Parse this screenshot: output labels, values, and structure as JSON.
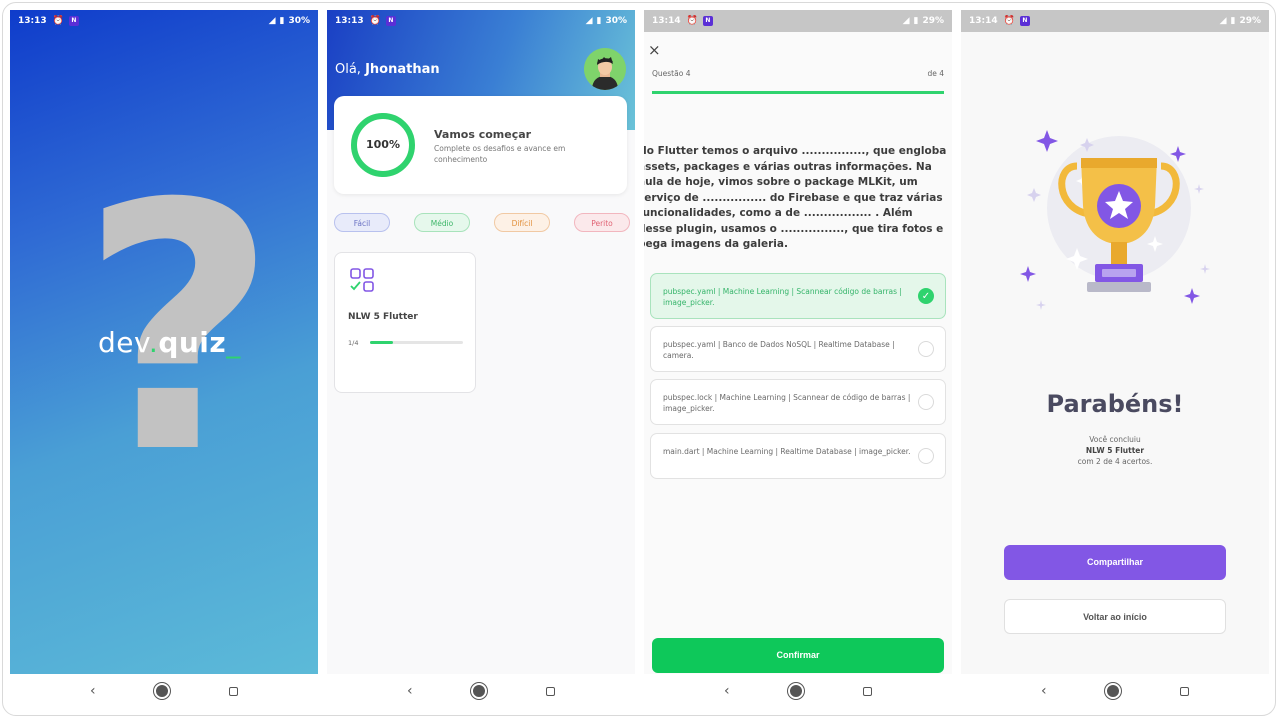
{
  "status_bars": [
    {
      "time": "13:13",
      "battery": "30%"
    },
    {
      "time": "13:13",
      "battery": "30%"
    },
    {
      "time": "13:14",
      "battery": "29%"
    },
    {
      "time": "13:14",
      "battery": "29%"
    }
  ],
  "status_app_badge": "N",
  "splash": {
    "symbol": "?",
    "logo_part1": "dev",
    "logo_dot": ".",
    "logo_part2": "quiz",
    "logo_cursor": "_"
  },
  "home": {
    "greeting": "Olá, ",
    "user_name": "Jhonathan",
    "progress_label": "100%",
    "progress_value": 1.0,
    "card_title": "Vamos começar",
    "card_subtitle": "Complete os desafios e avance em conhecimento",
    "levels": [
      "Fácil",
      "Médio",
      "Difícil",
      "Perito"
    ],
    "quiz": {
      "title": "NLW 5 Flutter",
      "progress_text": "1/4",
      "progress_value": 0.25
    }
  },
  "question": {
    "close_icon": "×",
    "number_label": "Questão 4",
    "of_label": "de 4",
    "progress_value": 1.0,
    "text": "No Flutter temos o arquivo ................, que engloba assets, packages e várias outras informações. Na aula de hoje, vimos sobre o package MLKit, um serviço de ................ do Firebase e que traz várias funcionalidades, como a de ................. . Além desse plugin, usamos o ................, que tira fotos e pega imagens da galeria.",
    "answers": [
      {
        "text": "pubspec.yaml | Machine Learning | Scannear código de barras | image_picker.",
        "correct": true
      },
      {
        "text": "pubspec.yaml | Banco de Dados NoSQL | Realtime Database | camera.",
        "correct": false
      },
      {
        "text": "pubspec.lock | Machine Learning | Scannear de código de barras | image_picker.",
        "correct": false
      },
      {
        "text": "main.dart | Machine Learning | Realtime Database | image_picker.",
        "correct": false
      }
    ],
    "check_icon": "✓",
    "confirm_label": "Confirmar"
  },
  "result": {
    "title": "Parabéns!",
    "line1": "Você concluiu",
    "quiz_name": "NLW 5 Flutter",
    "line3": "com 2 de 4 acertos.",
    "share_label": "Compartilhar",
    "home_label": "Voltar ao início"
  },
  "nav": {
    "back_icon": "‹"
  },
  "colors": {
    "accent_green": "#2fd36e",
    "purple": "#8257e5",
    "gradient_start": "#0f3ccb",
    "gradient_end": "#5cbad8"
  }
}
